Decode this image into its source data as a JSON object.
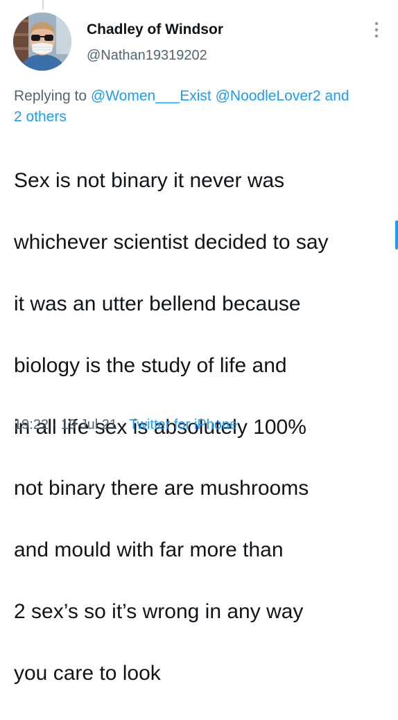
{
  "tweet": {
    "author": {
      "display_name": "Chadley of Windsor",
      "handle": "@Nathan19319202",
      "avatar_icon": "profile-photo-masked-person"
    },
    "more_icon": "vertical-ellipsis-icon",
    "replying": {
      "prefix": "Replying to",
      "mention_1": "@Women___Exist",
      "mention_2": "@NoodleLover2",
      "conjunction": "and",
      "others": "2 others"
    },
    "text_lines": [
      "Sex is not binary it never was",
      "whichever scientist decided to say",
      "it was an utter bellend because",
      "biology is the study of life and",
      "in all life sex is absolutely 100%",
      "not binary there are mushrooms",
      "and mould with far more than",
      "2 sex’s so it’s wrong in any way",
      "you care to look"
    ],
    "meta": {
      "time": "19:22",
      "separator": "·",
      "date": "19 Jul 21",
      "source": "Twitter for iPhone"
    }
  },
  "colors": {
    "link": "#1d9bf0",
    "secondary_text": "#536471",
    "primary_text": "#0f1419"
  }
}
